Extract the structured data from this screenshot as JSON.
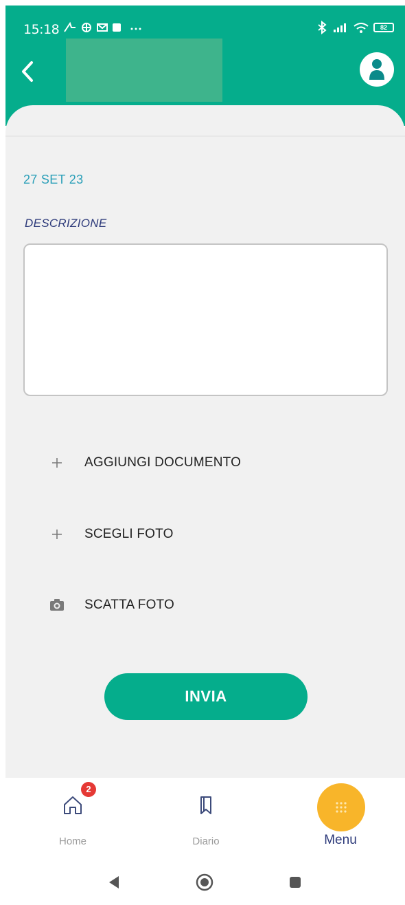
{
  "status_bar": {
    "time": "15:18",
    "battery": "82"
  },
  "header": {
    "back_icon": "chevron-left-icon",
    "avatar_icon": "user-icon"
  },
  "form": {
    "date": "27 SET 23",
    "description_label": "DESCRIZIONE",
    "description_value": "",
    "actions": [
      {
        "icon": "plus-icon",
        "label": "AGGIUNGI DOCUMENTO"
      },
      {
        "icon": "plus-icon",
        "label": "SCEGLI FOTO"
      },
      {
        "icon": "camera-icon",
        "label": "SCATTA FOTO"
      }
    ],
    "submit_label": "INVIA"
  },
  "bottom_nav": {
    "items": [
      {
        "label": "Home",
        "icon": "home-icon",
        "badge": "2"
      },
      {
        "label": "Diario",
        "icon": "bookmark-icon"
      },
      {
        "label": "Menu",
        "icon": "grid-dots-icon",
        "active": true
      }
    ]
  },
  "colors": {
    "primary": "#05ad8c",
    "accent": "#f8b52a",
    "date_text": "#2a9fb8",
    "label_text": "#2d3a7a",
    "badge": "#e53935"
  }
}
